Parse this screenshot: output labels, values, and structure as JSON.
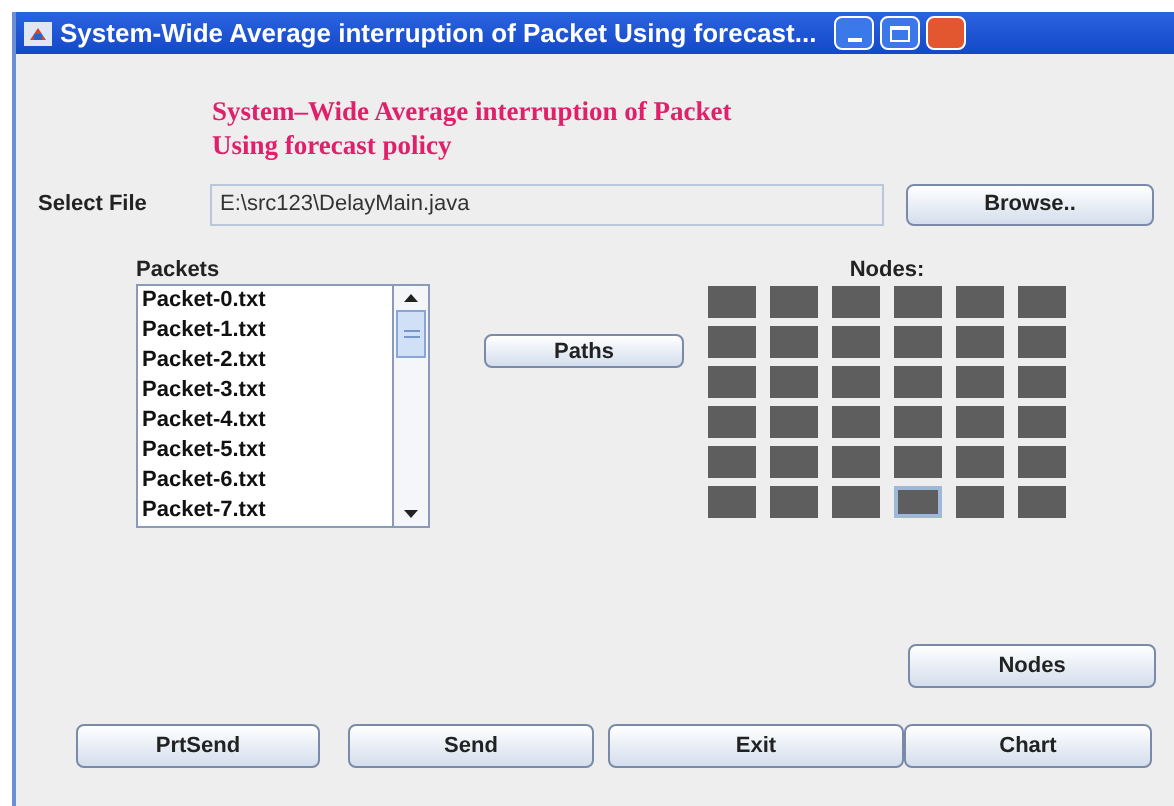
{
  "window": {
    "title": "System-Wide Average interruption of Packet Using forecast..."
  },
  "heading": {
    "lines": [
      "System–Wide Average interruption of Packet",
      "Using forecast policy"
    ]
  },
  "file": {
    "label": "Select File",
    "value": "E:\\src123\\DelayMain.java",
    "button": "Browse.."
  },
  "packets": {
    "label": "Packets",
    "items": [
      "Packet-0.txt",
      "Packet-1.txt",
      "Packet-2.txt",
      "Packet-3.txt",
      "Packet-4.txt",
      "Packet-5.txt",
      "Packet-6.txt",
      "Packet-7.txt"
    ]
  },
  "paths_button": "Paths",
  "nodes": {
    "label": "Nodes:",
    "cells": [
      {
        "selected": false
      },
      {
        "selected": false
      },
      {
        "selected": false
      },
      {
        "selected": false
      },
      {
        "selected": false
      },
      {
        "selected": false
      },
      {
        "selected": false
      },
      {
        "selected": false
      },
      {
        "selected": false
      },
      {
        "selected": false
      },
      {
        "selected": false
      },
      {
        "selected": false
      },
      {
        "selected": false
      },
      {
        "selected": false
      },
      {
        "selected": false
      },
      {
        "selected": false
      },
      {
        "selected": false
      },
      {
        "selected": false
      },
      {
        "selected": false
      },
      {
        "selected": false
      },
      {
        "selected": false
      },
      {
        "selected": false
      },
      {
        "selected": false
      },
      {
        "selected": false
      },
      {
        "selected": false
      },
      {
        "selected": false
      },
      {
        "selected": false
      },
      {
        "selected": false
      },
      {
        "selected": false
      },
      {
        "selected": false
      },
      {
        "selected": false
      },
      {
        "selected": false
      },
      {
        "selected": false
      },
      {
        "selected": true
      },
      {
        "selected": false
      },
      {
        "selected": false
      }
    ]
  },
  "nodes_button": "Nodes",
  "buttons": [
    "PrtSend",
    "Send",
    "Exit",
    "Chart"
  ]
}
